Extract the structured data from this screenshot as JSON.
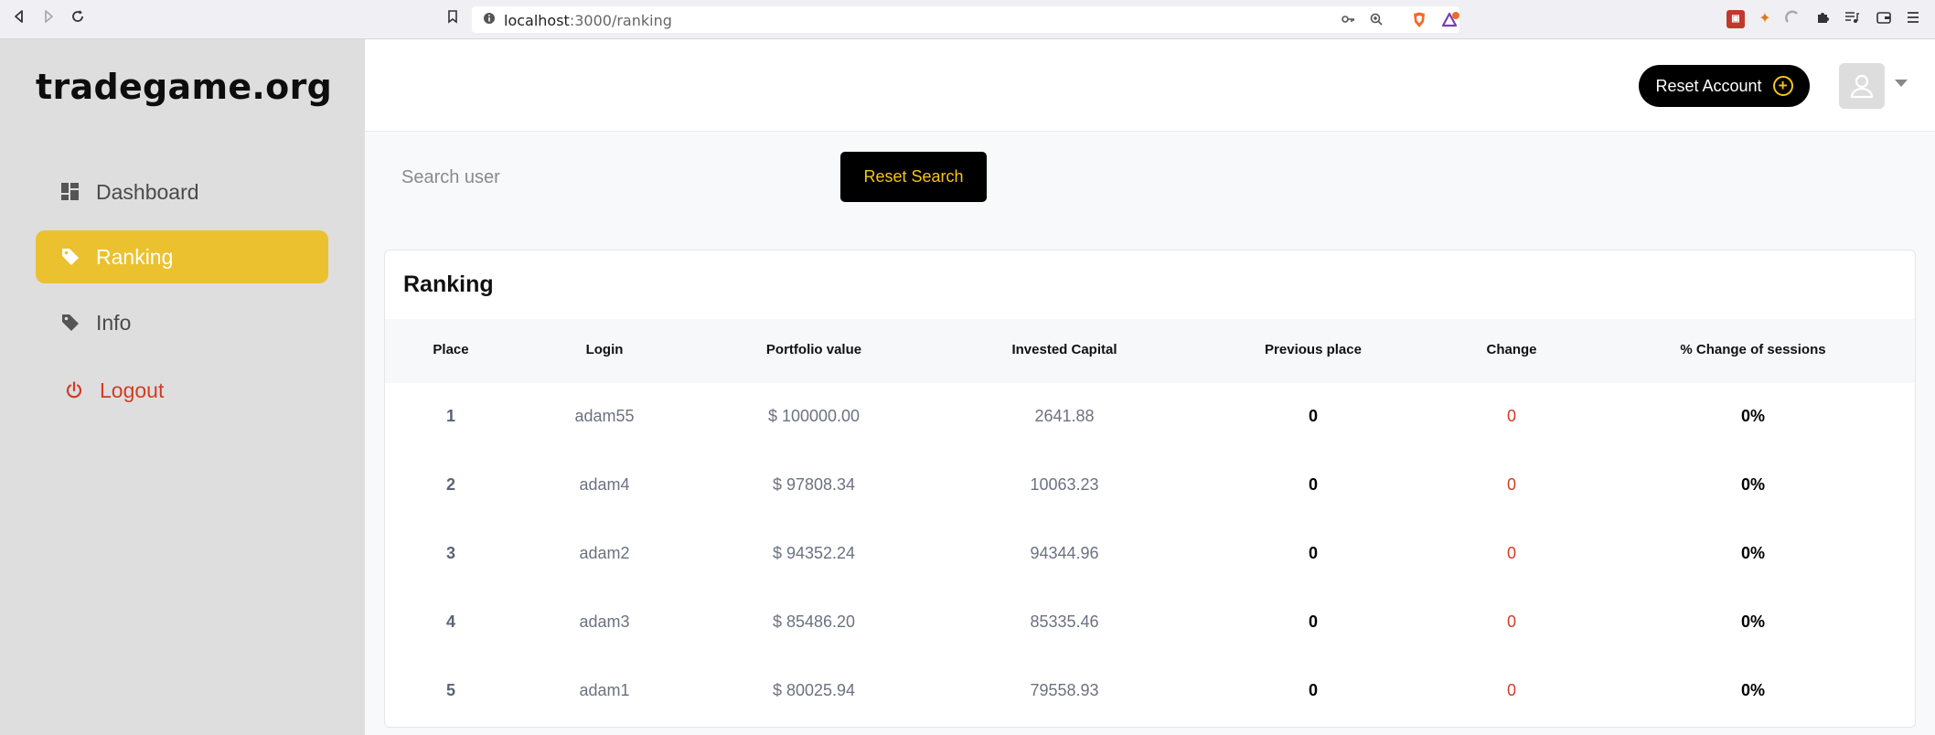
{
  "browser": {
    "url_host": "localhost",
    "url_path": ":3000/ranking"
  },
  "sidebar": {
    "brand": "tradegame.org",
    "items": [
      {
        "label": "Dashboard",
        "icon": "dashboard-icon"
      },
      {
        "label": "Ranking",
        "icon": "tag-icon",
        "active": true
      },
      {
        "label": "Info",
        "icon": "tag-icon"
      },
      {
        "label": "Logout",
        "icon": "power-icon"
      }
    ]
  },
  "header": {
    "reset_account_label": "Reset Account"
  },
  "search": {
    "placeholder": "Search user",
    "value": "",
    "reset_label": "Reset Search"
  },
  "ranking": {
    "title": "Ranking",
    "columns": [
      "Place",
      "Login",
      "Portfolio value",
      "Invested Capital",
      "Previous place",
      "Change",
      "% Change of sessions"
    ],
    "rows": [
      {
        "place": "1",
        "login": "adam55",
        "portfolio": "$ 100000.00",
        "capital": "2641.88",
        "previous": "0",
        "change": "0",
        "pct": "0%"
      },
      {
        "place": "2",
        "login": "adam4",
        "portfolio": "$ 97808.34",
        "capital": "10063.23",
        "previous": "0",
        "change": "0",
        "pct": "0%"
      },
      {
        "place": "3",
        "login": "adam2",
        "portfolio": "$ 94352.24",
        "capital": "94344.96",
        "previous": "0",
        "change": "0",
        "pct": "0%"
      },
      {
        "place": "4",
        "login": "adam3",
        "portfolio": "$ 85486.20",
        "capital": "85335.46",
        "previous": "0",
        "change": "0",
        "pct": "0%"
      },
      {
        "place": "5",
        "login": "adam1",
        "portfolio": "$ 80025.94",
        "capital": "79558.93",
        "previous": "0",
        "change": "0",
        "pct": "0%"
      }
    ]
  },
  "colors": {
    "accent": "#ebc12f",
    "sidebar_bg": "#dedede",
    "logout": "#d23b24",
    "change": "#d23b24"
  }
}
